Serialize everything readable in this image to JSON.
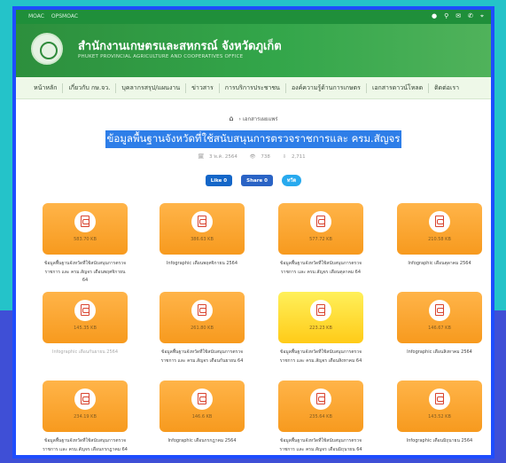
{
  "colors": {
    "header_green": "#2d8f3d",
    "title_highlight": "#2e7ee8",
    "tile_orange": "#f79a1e",
    "tile_yellow": "#ffcb18",
    "frame_blue": "#1e4dff"
  },
  "topbar": {
    "links": [
      "MOAC",
      "OPSMOAC"
    ],
    "icons": [
      "person-icon",
      "search-icon",
      "mail-icon",
      "phone-icon",
      "location-icon"
    ]
  },
  "header": {
    "title": "สำนักงานเกษตรและสหกรณ์ จังหวัดภูเก็ต",
    "subtitle": "PHUKET PROVINCIAL AGRICULTURE AND COOPERATIVES OFFICE"
  },
  "nav": [
    "หน้าหลัก",
    "เกี่ยวกับ กษ.จว.",
    "บุคลากรสรุป/แผนงาน",
    "ข่าวสาร",
    "การบริการประชาชน",
    "องค์ความรู้ด้านการเกษตร",
    "เอกสารดาวน์โหลด",
    "ติดต่อเรา"
  ],
  "breadcrumb": {
    "current": "เอกสารเผยแพร่"
  },
  "page": {
    "title": "ข้อมูลพื้นฐานจังหวัดที่ใช้สนับสนุนการตรวจราชการและ ครม.สัญจร",
    "date": "3 พ.ค. 2564",
    "views": "738",
    "downloads": "2,711"
  },
  "social": {
    "like": "Like 0",
    "share": "Share 0",
    "tweet": "ทวีต"
  },
  "files": [
    {
      "size": "583.70 KB",
      "caption": "ข้อมูลพื้นฐานจังหวัดที่ใช้สนับสนุนการตรวจราชการ และ ครม.สัญจร เดือนพฤศจิกายน 64"
    },
    {
      "size": "386.63 KB",
      "caption": "Infographic เดือนพฤศจิกายน 2564"
    },
    {
      "size": "577.72 KB",
      "caption": "ข้อมูลพื้นฐานจังหวัดที่ใช้สนับสนุนการตรวจราชการ และ ครม.สัญจร เดือนตุลาคม 64"
    },
    {
      "size": "210.58 KB",
      "caption": "Infographic เดือนตุลาคม 2564"
    },
    {
      "size": "145.35 KB",
      "caption": "Infographic เดือนกันยายน 2564"
    },
    {
      "size": "261.80 KB",
      "caption": "ข้อมูลพื้นฐานจังหวัดที่ใช้สนับสนุนการตรวจราชการ และ ครม.สัญจร เดือนกันยายน 64"
    },
    {
      "size": "223.23 KB",
      "caption": "ข้อมูลพื้นฐานจังหวัดที่ใช้สนับสนุนการตรวจราชการ และ ครม.สัญจร เดือนสิงหาคม 64"
    },
    {
      "size": "146.67 KB",
      "caption": "Infographic เดือนสิงหาคม 2564"
    },
    {
      "size": "234.19 KB",
      "caption": "ข้อมูลพื้นฐานจังหวัดที่ใช้สนับสนุนการตรวจราชการ และ ครม.สัญจร เดือนกรกฎาคม 64"
    },
    {
      "size": "146.6 KB",
      "caption": "Infographic เดือนกรกฎาคม 2564"
    },
    {
      "size": "235.64 KB",
      "caption": "ข้อมูลพื้นฐานจังหวัดที่ใช้สนับสนุนการตรวจราชการ และ ครม.สัญจร เดือนมิถุนายน 64"
    },
    {
      "size": "143.52 KB",
      "caption": "Infographic เดือนมิถุนายน 2564"
    }
  ]
}
